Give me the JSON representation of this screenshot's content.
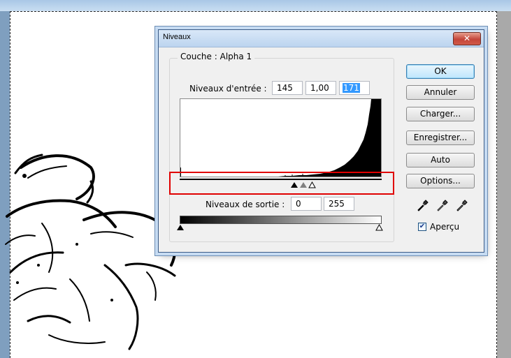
{
  "dialog": {
    "title": "Niveaux",
    "close_glyph": "✕",
    "channel_label": "Couche :",
    "channel_value": "Alpha 1",
    "input_levels_label": "Niveaux d'entrée :",
    "input_black": "145",
    "input_gamma": "1,00",
    "input_white": "171",
    "output_levels_label": "Niveaux de sortie :",
    "output_black": "0",
    "output_white": "255",
    "buttons": {
      "ok": "OK",
      "cancel": "Annuler",
      "load": "Charger...",
      "save": "Enregistrer...",
      "auto": "Auto",
      "options": "Options..."
    },
    "preview_label": "Aperçu",
    "preview_checked": true
  },
  "icons": [
    "close-icon",
    "black-eyedropper-icon",
    "gray-eyedropper-icon",
    "white-eyedropper-icon"
  ],
  "colors": {
    "highlight": "#e00000",
    "selection": "#3399ff",
    "default_button": "#3c7fb1"
  }
}
